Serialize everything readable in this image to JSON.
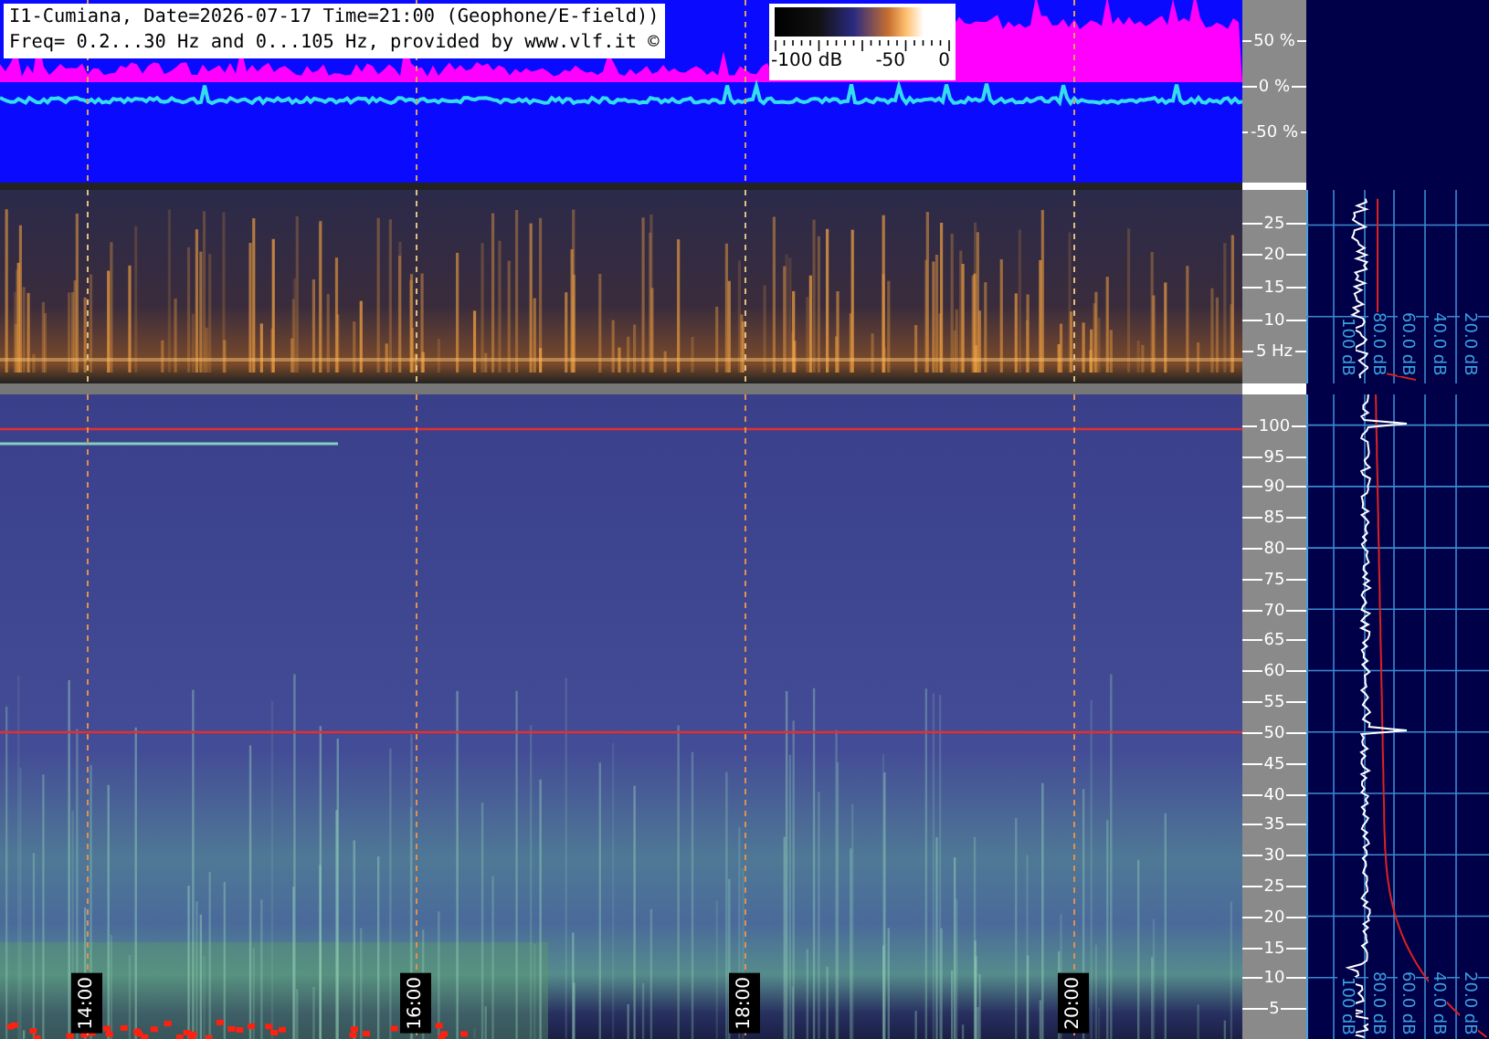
{
  "header": {
    "title_line": "I1-Cumiana, Date=2026-07-17 Time=21:00 (Geophone/E-field))",
    "freq_line": "Freq= 0.2...30 Hz and 0...105 Hz, provided by www.vlf.it ©"
  },
  "colorbar": {
    "labels": [
      "-100 dB",
      "-50",
      "0"
    ]
  },
  "waveform_axis": {
    "ticks": [
      "50 %",
      "0 %",
      "-50 %"
    ]
  },
  "spectrogram_low": {
    "freq_ticks": [
      "25",
      "20",
      "15",
      "10",
      "5 Hz"
    ]
  },
  "spectrogram_high": {
    "freq_ticks": [
      "100",
      "95",
      "90",
      "85",
      "80",
      "75",
      "70",
      "65",
      "60",
      "55",
      "50",
      "45",
      "40",
      "35",
      "30",
      "25",
      "20",
      "15",
      "10",
      "5"
    ]
  },
  "time_markers": [
    "14:00",
    "16:00",
    "18:00",
    "20:00"
  ],
  "spectrum_low": {
    "db_labels": [
      "100 dB",
      "80.0 dB",
      "60.0 dB",
      "40.0 dB",
      "20.0 dB"
    ]
  },
  "spectrum_high": {
    "db_labels": [
      "100 dB",
      "80.0 dB",
      "60.0 dB",
      "40.0 dB",
      "20.0 dB"
    ]
  }
}
